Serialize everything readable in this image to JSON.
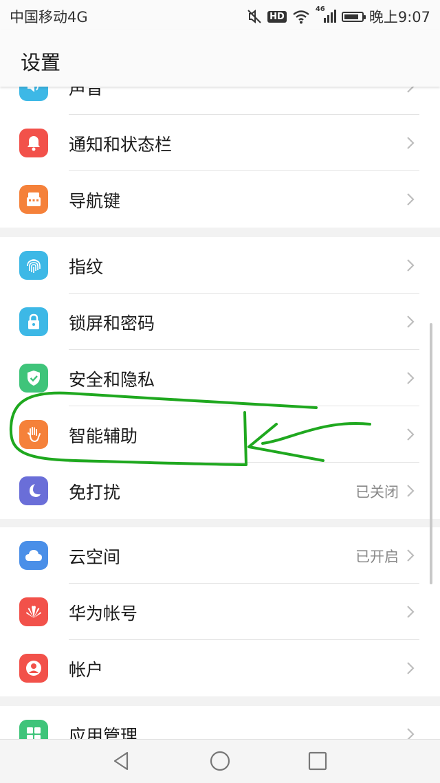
{
  "status_bar": {
    "carrier": "中国移动4G",
    "hd": "HD",
    "network": "46",
    "time": "晚上9:07",
    "battery_level": 0.85
  },
  "header": {
    "title": "设置"
  },
  "groups": [
    [
      {
        "label": "声音",
        "icon": "speaker-icon",
        "color": "#3db8e6"
      },
      {
        "label": "通知和状态栏",
        "icon": "bell-icon",
        "color": "#f2514a"
      },
      {
        "label": "导航键",
        "icon": "navigation-keys-icon",
        "color": "#f5813a"
      }
    ],
    [
      {
        "label": "指纹",
        "icon": "fingerprint-icon",
        "color": "#3db8e6"
      },
      {
        "label": "锁屏和密码",
        "icon": "lock-icon",
        "color": "#3db8e6"
      },
      {
        "label": "安全和隐私",
        "icon": "shield-icon",
        "color": "#3fc47a"
      },
      {
        "label": "智能辅助",
        "icon": "hand-icon",
        "color": "#f5813a"
      },
      {
        "label": "免打扰",
        "icon": "moon-icon",
        "color": "#6a6ed8",
        "value": "已关闭"
      }
    ],
    [
      {
        "label": "云空间",
        "icon": "cloud-icon",
        "color": "#4a8fe8",
        "value": "已开启"
      },
      {
        "label": "华为帐号",
        "icon": "huawei-logo-icon",
        "color": "#f2514a"
      },
      {
        "label": "帐户",
        "icon": "person-icon",
        "color": "#f2514a"
      }
    ],
    [
      {
        "label": "应用管理",
        "icon": "apps-icon",
        "color": "#3fc47a"
      }
    ]
  ],
  "colors": {
    "annotation": "#1fa81f",
    "red": "#f2514a",
    "orange": "#f5813a",
    "cyan": "#3db8e6",
    "green": "#3fc47a",
    "purple": "#6a6ed8",
    "blue": "#4a8fe8"
  }
}
